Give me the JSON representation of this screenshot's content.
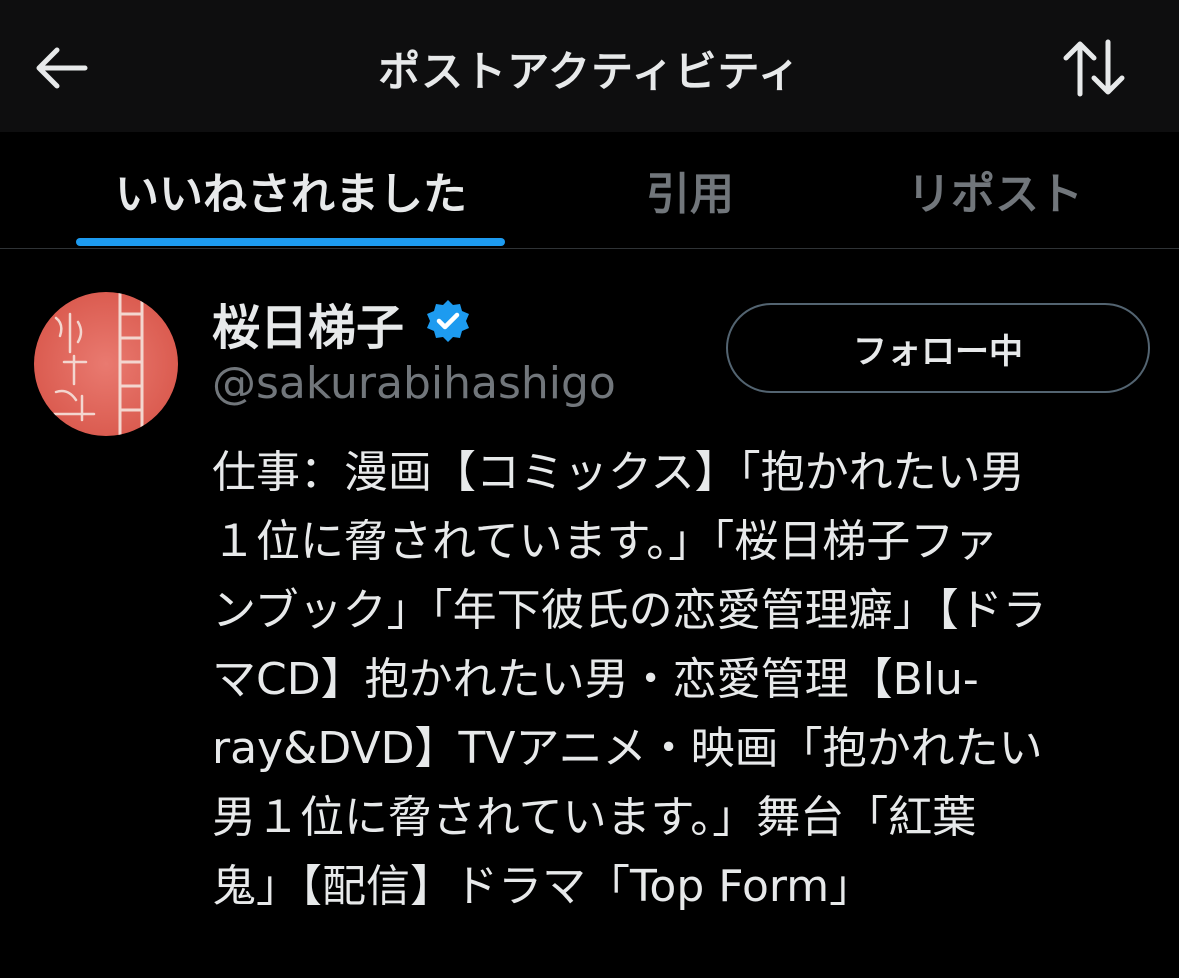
{
  "header": {
    "title": "ポストアクティビティ",
    "back_icon": "arrow-left-icon",
    "sort_icon": "sort-arrows-icon"
  },
  "tabs": [
    {
      "label": "いいねされました",
      "active": true
    },
    {
      "label": "引用",
      "active": false
    },
    {
      "label": "リポスト",
      "active": false
    }
  ],
  "user": {
    "name": "桜日梯子",
    "verified": true,
    "handle": "@sakurabihashigo",
    "follow_label": "フォロー中",
    "bio_lines": [
      "仕事：漫画【コミックス】「抱かれたい男",
      "１位に脅されています。」「桜日梯子ファ",
      "ンブック」「年下彼氏の恋愛管理癖」【ドラ",
      "マCD】抱かれたい男・恋愛管理【Blu-",
      "ray&DVD】TVアニメ・映画「抱かれたい",
      "男１位に脅されています。」舞台「紅葉",
      "鬼」【配信】ドラマ「Top Form」"
    ]
  },
  "colors": {
    "background": "#000000",
    "header_background": "#0e0e0f",
    "accent": "#1d9bf0",
    "text_primary": "#e7e9ea",
    "text_secondary": "#71767b",
    "button_border": "#536471"
  }
}
